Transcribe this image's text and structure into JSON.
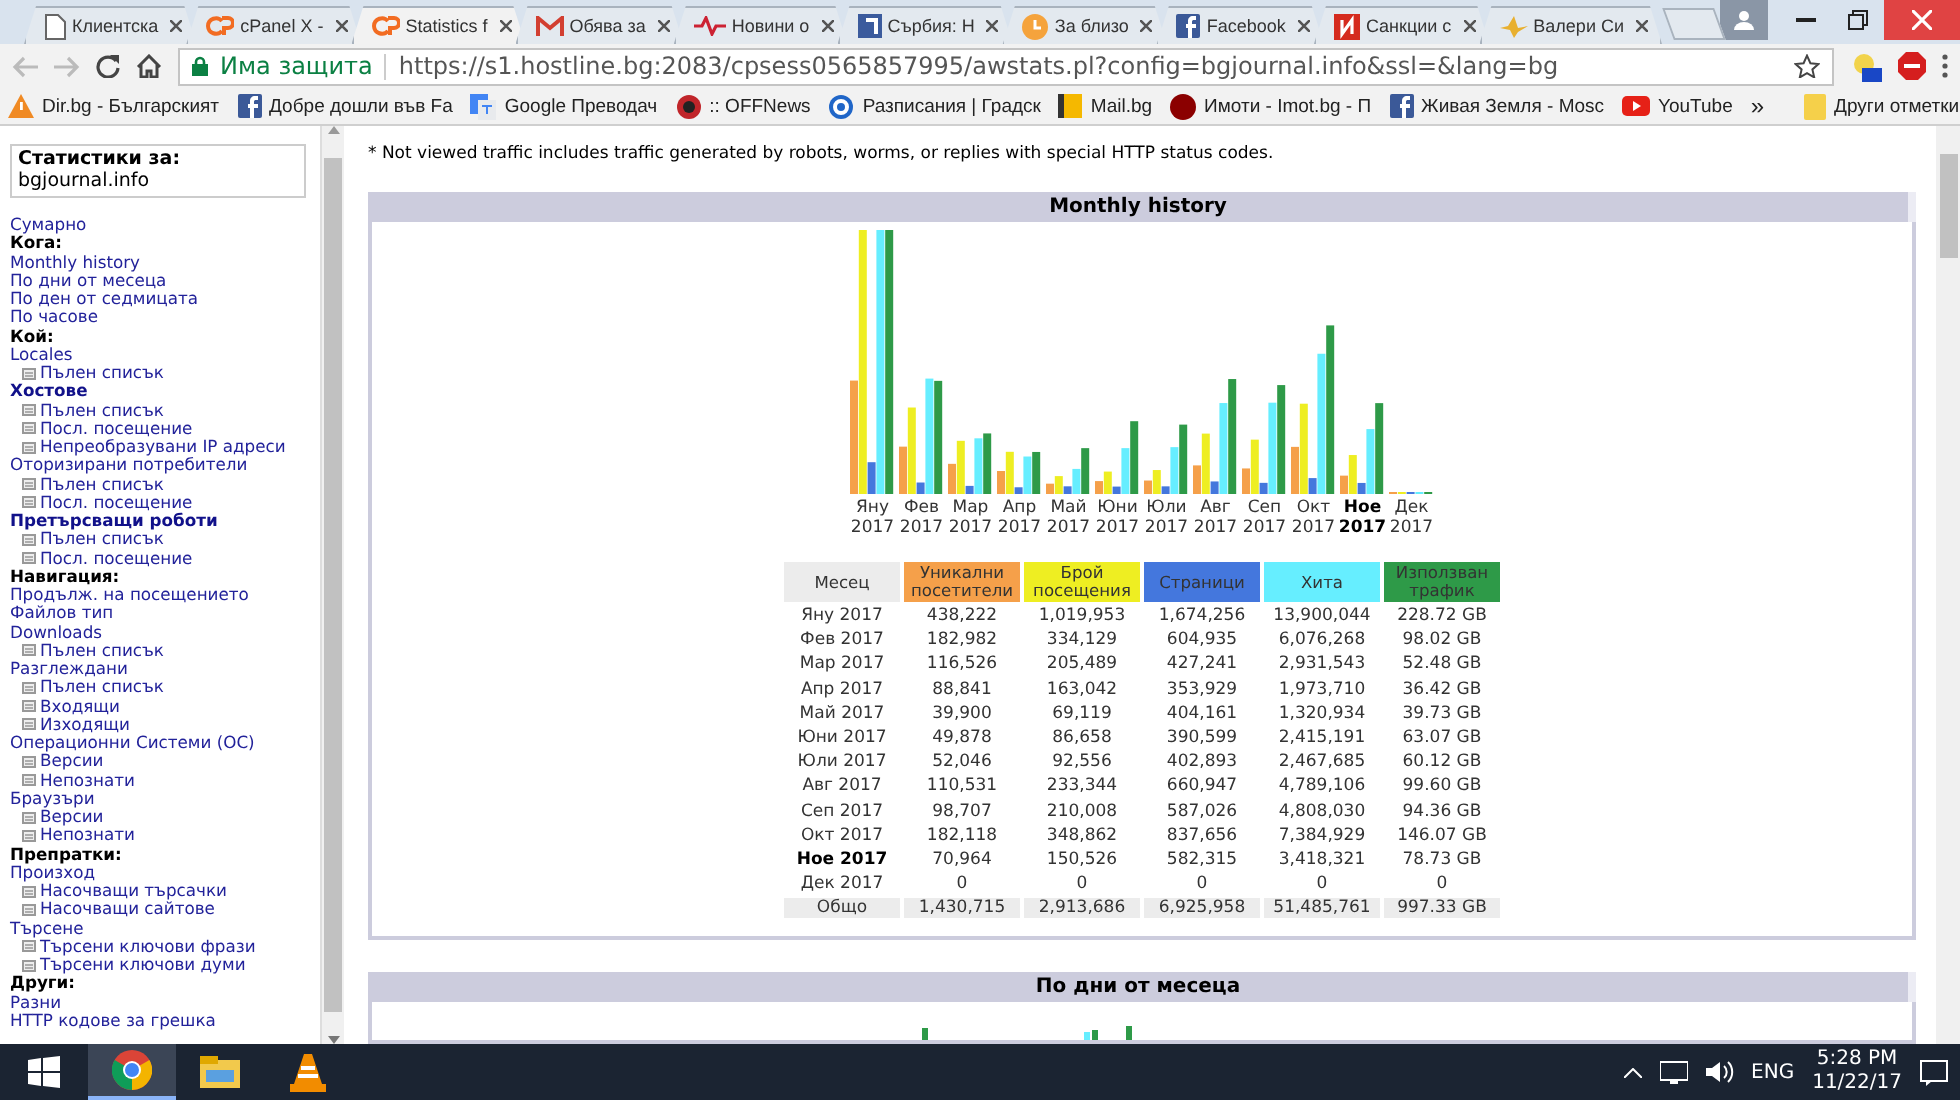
{
  "tabs": [
    {
      "title": "Клиентска",
      "kind": "page",
      "selected": false
    },
    {
      "title": "cPanel X -",
      "kind": "cpanel",
      "selected": false
    },
    {
      "title": "Statistics f",
      "kind": "cpanel",
      "selected": true
    },
    {
      "title": "Обява за",
      "kind": "mail",
      "selected": false
    },
    {
      "title": "Новини о",
      "kind": "wave",
      "selected": false
    },
    {
      "title": "Сърбия: Н",
      "kind": "square",
      "selected": false
    },
    {
      "title": "За близо",
      "kind": "clock",
      "selected": false
    },
    {
      "title": "Facebook",
      "kind": "facebook",
      "selected": false
    },
    {
      "title": "Санкции с",
      "kind": "red",
      "selected": false
    },
    {
      "title": "Валери Си",
      "kind": "star",
      "selected": false
    }
  ],
  "address_bar": {
    "security": "Има защита",
    "url": "https://s1.hostline.bg:2083/cpsess0565857995/awstats.pl?config=bgjournal.info&ssl=&lang=bg"
  },
  "bookmarks": [
    {
      "label": "Dir.bg - Българският",
      "kind": "warning"
    },
    {
      "label": "Добре дошли във Fa",
      "kind": "facebook"
    },
    {
      "label": "Google Преводач",
      "kind": "translate"
    },
    {
      "label": ":: OFFNews",
      "kind": "dark"
    },
    {
      "label": "Разписания | Градск",
      "kind": "circle"
    },
    {
      "label": "Mail.bg",
      "kind": "mail"
    },
    {
      "label": "Имоти - Imot.bg - П",
      "kind": "dot"
    },
    {
      "label": "Живая Земля - Mosc",
      "kind": "facebook"
    },
    {
      "label": "YouTube",
      "kind": "youtube"
    }
  ],
  "bookmarks_more": "»",
  "other_bookmarks": "Други отметки",
  "sidebar": {
    "title": "Статистики за:",
    "site": "bgjournal.info",
    "items": [
      {
        "label": "Сумарно",
        "kind": "link"
      },
      {
        "label": "Кога:",
        "kind": "heading"
      },
      {
        "label": "Monthly history",
        "kind": "link"
      },
      {
        "label": "По дни от месеца",
        "kind": "link"
      },
      {
        "label": "По ден от седмицата",
        "kind": "link"
      },
      {
        "label": "По часове",
        "kind": "link"
      },
      {
        "label": "Кой:",
        "kind": "heading"
      },
      {
        "label": "Locales",
        "kind": "link",
        "children": [
          {
            "label": "Пълен списък"
          }
        ]
      },
      {
        "label": "Хостове",
        "kind": "section",
        "children": [
          {
            "label": "Пълен списък"
          },
          {
            "label": "Посл. посещение"
          },
          {
            "label": "Непреобразувани IP адреси"
          }
        ]
      },
      {
        "label": "Оторизирани потребители",
        "kind": "link",
        "children": [
          {
            "label": "Пълен списък"
          },
          {
            "label": "Посл. посещение"
          }
        ]
      },
      {
        "label": "Претърсващи роботи",
        "kind": "section",
        "children": [
          {
            "label": "Пълен списък"
          },
          {
            "label": "Посл. посещение"
          }
        ]
      },
      {
        "label": "Навигация:",
        "kind": "heading"
      },
      {
        "label": "Продълж. на посещението",
        "kind": "link"
      },
      {
        "label": "Файлов тип",
        "kind": "link"
      },
      {
        "label": "Downloads",
        "kind": "link",
        "children": [
          {
            "label": "Пълен списък"
          }
        ]
      },
      {
        "label": "Разглеждани",
        "kind": "link",
        "children": [
          {
            "label": "Пълен списък"
          },
          {
            "label": "Входящи"
          },
          {
            "label": "Изходящи"
          }
        ]
      },
      {
        "label": "Операционни Системи (ОС)",
        "kind": "link",
        "children": [
          {
            "label": "Версии"
          },
          {
            "label": "Непознати"
          }
        ]
      },
      {
        "label": "Браузъри",
        "kind": "link",
        "children": [
          {
            "label": "Версии"
          },
          {
            "label": "Непознати"
          }
        ]
      },
      {
        "label": "Препратки:",
        "kind": "heading"
      },
      {
        "label": "Произход",
        "kind": "link",
        "children": [
          {
            "label": "Насочващи търсачки"
          },
          {
            "label": "Насочващи сайтове"
          }
        ]
      },
      {
        "label": "Търсене",
        "kind": "link",
        "children": [
          {
            "label": "Търсени ключови фрази"
          },
          {
            "label": "Търсени ключови думи"
          }
        ]
      },
      {
        "label": "Други:",
        "kind": "heading"
      },
      {
        "label": "Разни",
        "kind": "link"
      },
      {
        "label": "HTTP кодове за грешка",
        "kind": "link"
      }
    ]
  },
  "note": "* Not viewed traffic includes traffic generated by robots, worms, or replies with special HTTP status codes.",
  "monthly": {
    "title": "Monthly history",
    "chart_labels": [
      {
        "month": "Яну",
        "year": "2017",
        "current": false
      },
      {
        "month": "Фев",
        "year": "2017",
        "current": false
      },
      {
        "month": "Мар",
        "year": "2017",
        "current": false
      },
      {
        "month": "Апр",
        "year": "2017",
        "current": false
      },
      {
        "month": "Май",
        "year": "2017",
        "current": false
      },
      {
        "month": "Юни",
        "year": "2017",
        "current": false
      },
      {
        "month": "Юли",
        "year": "2017",
        "current": false
      },
      {
        "month": "Авг",
        "year": "2017",
        "current": false
      },
      {
        "month": "Сеп",
        "year": "2017",
        "current": false
      },
      {
        "month": "Окт",
        "year": "2017",
        "current": false
      },
      {
        "month": "Ное",
        "year": "2017",
        "current": true
      },
      {
        "month": "Дек",
        "year": "2017",
        "current": false
      }
    ],
    "columns": [
      {
        "label": "Месец"
      },
      {
        "label": "Уникални посетители",
        "color": "#f5a04a"
      },
      {
        "label": "Брой посещения",
        "color": "#eeee22"
      },
      {
        "label": "Страници",
        "color": "#4477dd"
      },
      {
        "label": "Хита",
        "color": "#66eeff"
      },
      {
        "label": "Използван трафик",
        "color": "#2e9a48"
      }
    ],
    "rows": [
      {
        "cells": [
          "Яну 2017",
          "438,222",
          "1,019,953",
          "1,674,256",
          "13,900,044",
          "228.72 GB"
        ],
        "current": false
      },
      {
        "cells": [
          "Фев 2017",
          "182,982",
          "334,129",
          "604,935",
          "6,076,268",
          "98.02 GB"
        ],
        "current": false
      },
      {
        "cells": [
          "Мар 2017",
          "116,526",
          "205,489",
          "427,241",
          "2,931,543",
          "52.48 GB"
        ],
        "current": false
      },
      {
        "cells": [
          "Апр 2017",
          "88,841",
          "163,042",
          "353,929",
          "1,973,710",
          "36.42 GB"
        ],
        "current": false
      },
      {
        "cells": [
          "Май 2017",
          "39,900",
          "69,119",
          "404,161",
          "1,320,934",
          "39.73 GB"
        ],
        "current": false
      },
      {
        "cells": [
          "Юни 2017",
          "49,878",
          "86,658",
          "390,599",
          "2,415,191",
          "63.07 GB"
        ],
        "current": false
      },
      {
        "cells": [
          "Юли 2017",
          "52,046",
          "92,556",
          "402,893",
          "2,467,685",
          "60.12 GB"
        ],
        "current": false
      },
      {
        "cells": [
          "Авг 2017",
          "110,531",
          "233,344",
          "660,947",
          "4,789,106",
          "99.60 GB"
        ],
        "current": false
      },
      {
        "cells": [
          "Сеп 2017",
          "98,707",
          "210,008",
          "587,026",
          "4,808,030",
          "94.36 GB"
        ],
        "current": false
      },
      {
        "cells": [
          "Окт 2017",
          "182,118",
          "348,862",
          "837,656",
          "7,384,929",
          "146.07 GB"
        ],
        "current": false
      },
      {
        "cells": [
          "Ное 2017",
          "70,964",
          "150,526",
          "582,315",
          "3,418,321",
          "78.73 GB"
        ],
        "current": true
      },
      {
        "cells": [
          "Дек 2017",
          "0",
          "0",
          "0",
          "0",
          "0"
        ],
        "current": false
      }
    ],
    "total": [
      "Общо",
      "1,430,715",
      "2,913,686",
      "6,925,958",
      "51,485,761",
      "997.33 GB"
    ]
  },
  "daily": {
    "title": "По дни от месеца"
  },
  "taskbar": {
    "language": "ENG",
    "time": "5:28 PM",
    "date": "11/22/17"
  }
}
